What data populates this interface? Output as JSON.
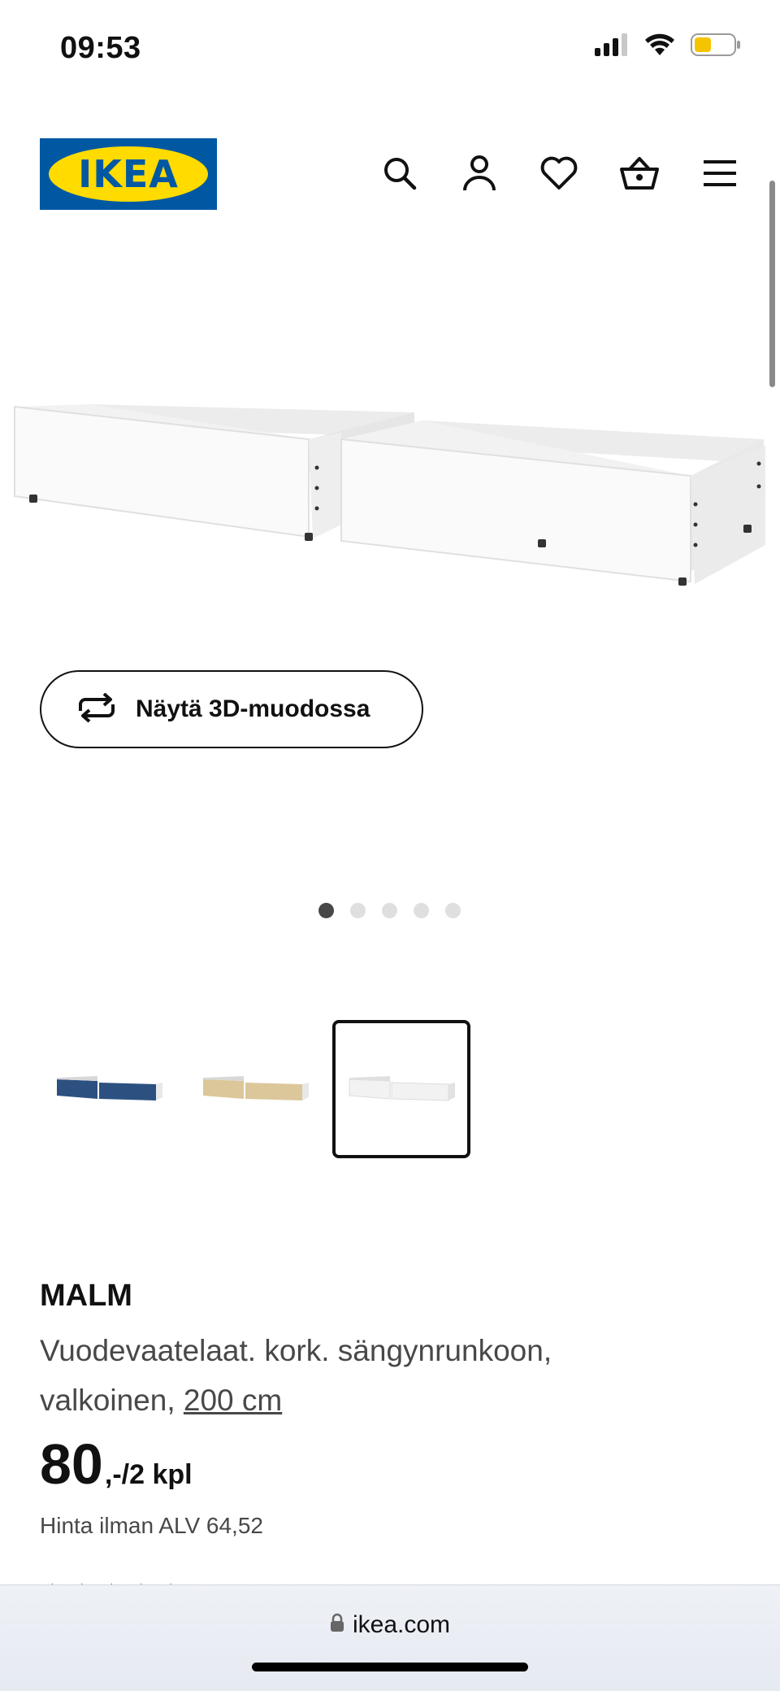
{
  "status_bar": {
    "time": "09:53",
    "battery_color": "#f5c400"
  },
  "header": {
    "logo_text": "IKEA",
    "brand_blue": "#0058a3",
    "brand_yellow": "#ffdb00",
    "icons": [
      "search-icon",
      "account-icon",
      "heart-icon",
      "basket-icon",
      "menu-icon"
    ]
  },
  "gallery": {
    "view_3d_label": "Näytä 3D-muodossa",
    "slide_count": 5,
    "active_slide": 1
  },
  "variants": [
    {
      "color": "#2c5180"
    },
    {
      "color": "#dcc79a"
    },
    {
      "color": "#f2f2f2"
    }
  ],
  "product": {
    "name": "MALM",
    "description": "Vuodevaatelaat. kork. sängynrunkoon, valkoinen,",
    "size_link": "200 cm",
    "price_main": "80",
    "price_suffix": ",-/2 kpl",
    "price_vat": "Hinta ilman ALV 64,52"
  },
  "browser": {
    "url": "ikea.com"
  }
}
